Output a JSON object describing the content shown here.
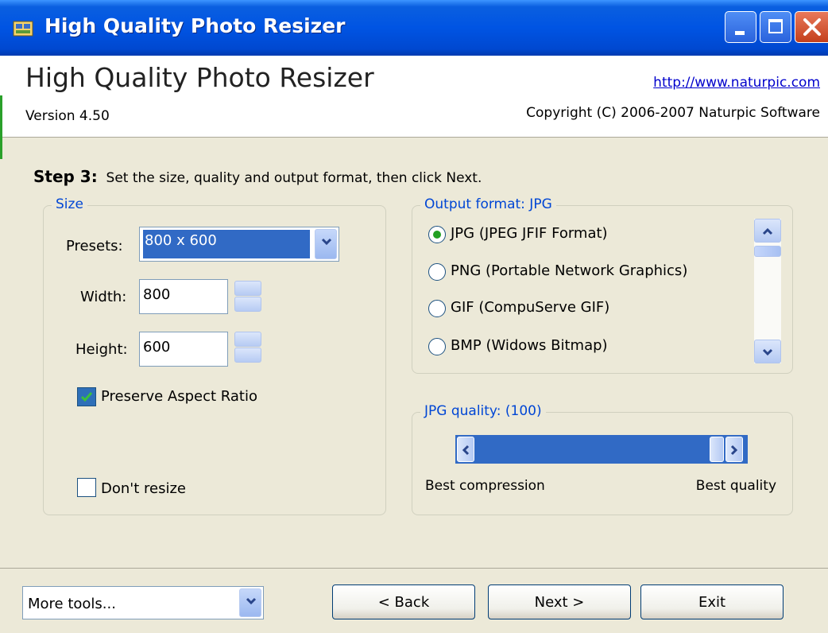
{
  "window": {
    "title": "High Quality Photo Resizer"
  },
  "header": {
    "app_name": "High Quality Photo Resizer",
    "version": "Version 4.50",
    "url": "http://www.naturpic.com",
    "copyright": "Copyright (C) 2006-2007 Naturpic Software"
  },
  "step": {
    "label": "Step 3:",
    "text": "Set the size, quality and output format, then click Next."
  },
  "size": {
    "legend": "Size",
    "presets_label": "Presets:",
    "presets_value": "800 x 600",
    "width_label": "Width:",
    "width_value": "800",
    "height_label": "Height:",
    "height_value": "600",
    "preserve_label": "Preserve Aspect Ratio",
    "preserve_checked": true,
    "dont_resize_label": "Don't resize",
    "dont_resize_checked": false
  },
  "output": {
    "legend": "Output format: JPG",
    "options": [
      {
        "label": "JPG (JPEG JFIF Format)",
        "selected": true
      },
      {
        "label": "PNG (Portable Network Graphics)",
        "selected": false
      },
      {
        "label": "GIF (CompuServe GIF)",
        "selected": false
      },
      {
        "label": "BMP (Widows Bitmap)",
        "selected": false
      }
    ]
  },
  "quality": {
    "legend": "JPG quality: (100)",
    "value": 100,
    "min_label": "Best compression",
    "max_label": "Best quality"
  },
  "footer": {
    "tools_value": "More tools...",
    "back_label": "< Back",
    "next_label": "Next >",
    "exit_label": "Exit"
  },
  "colors": {
    "titlebar": "#0054e3",
    "selection": "#316ac5",
    "legend_text": "#0046d5",
    "link": "#0000cc"
  }
}
